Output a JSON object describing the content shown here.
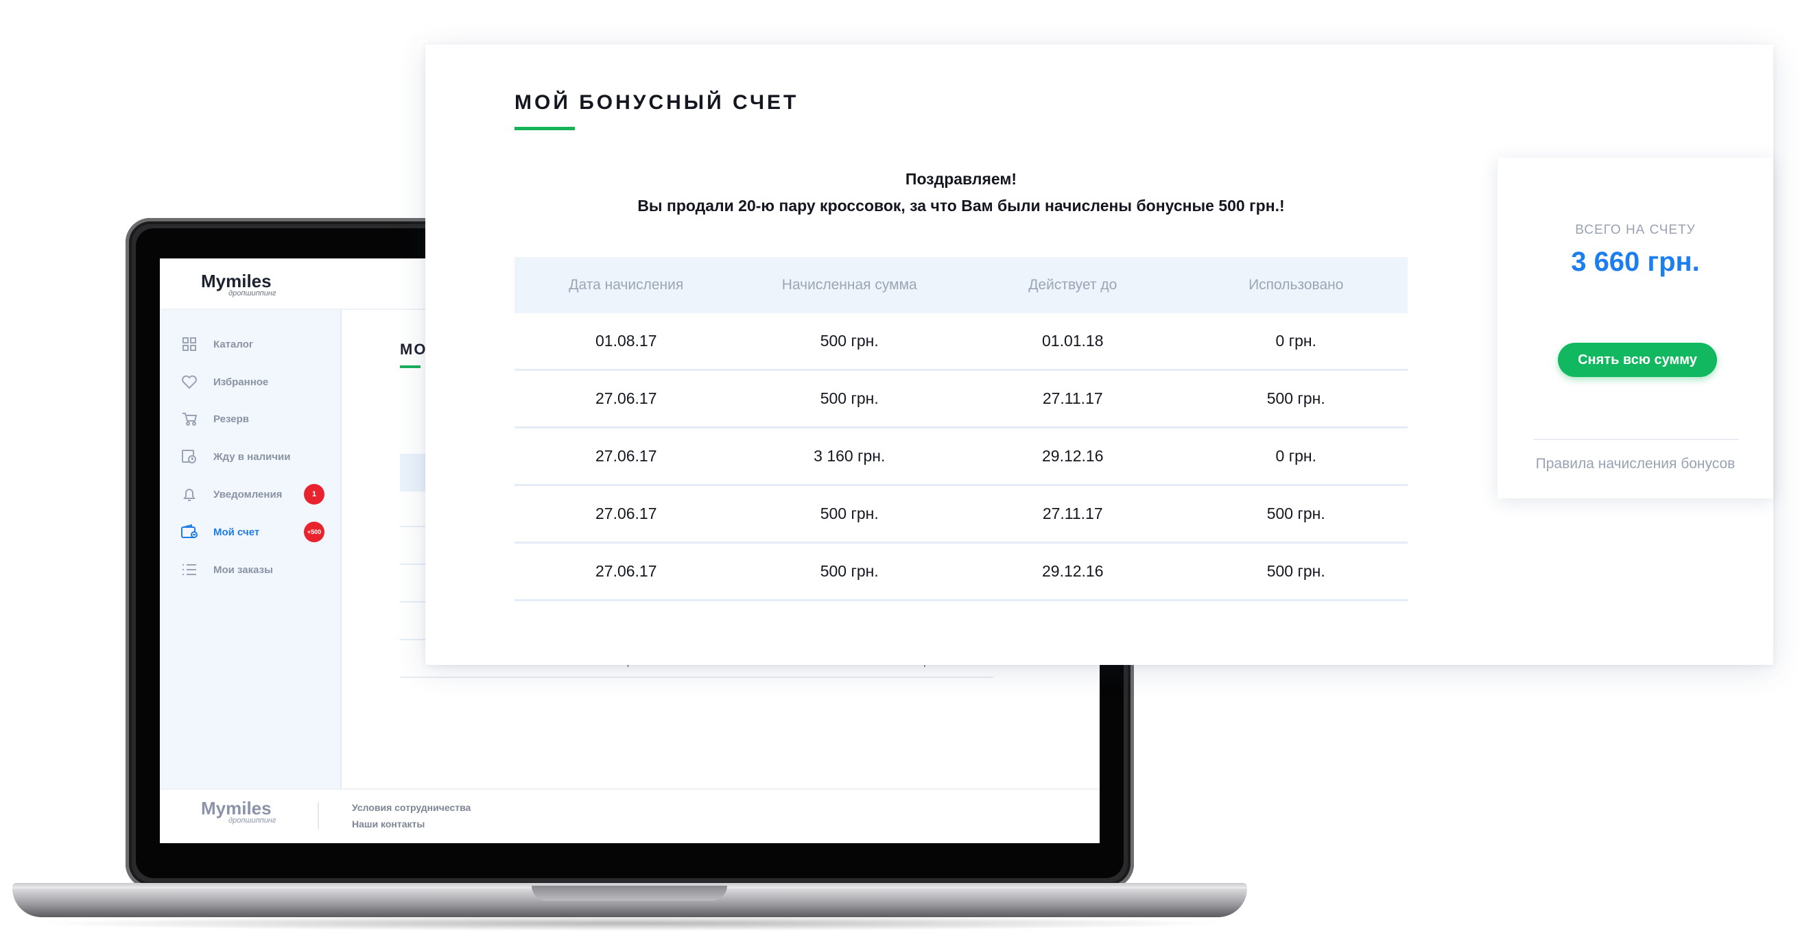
{
  "laptop": {
    "logo": "Mymiles",
    "logo_sub": "дропшиппинг",
    "sidebar_items": [
      {
        "label": "Каталог",
        "icon": "grid-icon"
      },
      {
        "label": "Избранное",
        "icon": "heart-icon"
      },
      {
        "label": "Резерв",
        "icon": "cart-icon"
      },
      {
        "label": "Жду в наличии",
        "icon": "clock-icon"
      },
      {
        "label": "Уведомления",
        "icon": "bell-icon",
        "badge": "1"
      },
      {
        "label": "Мой счет",
        "icon": "wallet-icon",
        "badge": "+500",
        "active": true
      },
      {
        "label": "Мои заказы",
        "icon": "list-icon"
      }
    ],
    "page_title_partial": "МО",
    "last_row": [
      "27.06.17",
      "500 грн.",
      "29.12.16",
      "500 грн."
    ],
    "footer": {
      "logo": "Mymiles",
      "logo_sub": "дропшиппинг",
      "links": [
        "Условия сотрудничества",
        "Наши контакты"
      ]
    }
  },
  "panel": {
    "title": "МОЙ БОНУСНЫЙ СЧЕТ",
    "message_line1": "Поздравляем!",
    "message_line2": "Вы продали 20-ю пару кроссовок, за что Вам были начислены бонусные 500 грн.!",
    "columns": [
      "Дата начисления",
      "Начисленная сумма",
      "Действует до",
      "Использовано"
    ],
    "rows": [
      [
        "01.08.17",
        "500 грн.",
        "01.01.18",
        "0 грн."
      ],
      [
        "27.06.17",
        "500 грн.",
        "27.11.17",
        "500 грн."
      ],
      [
        "27.06.17",
        "3 160 грн.",
        "29.12.16",
        "0 грн."
      ],
      [
        "27.06.17",
        "500 грн.",
        "27.11.17",
        "500 грн."
      ],
      [
        "27.06.17",
        "500 грн.",
        "29.12.16",
        "500 грн."
      ]
    ]
  },
  "balance": {
    "label": "ВСЕГО НА СЧЕТУ",
    "amount": "3 660 грн.",
    "withdraw_label": "Снять всю сумму",
    "rules_link": "Правила начисления бонусов"
  },
  "colors": {
    "accent_blue": "#1d7ef0",
    "accent_green": "#12b85f",
    "badge_red": "#e8232e"
  }
}
